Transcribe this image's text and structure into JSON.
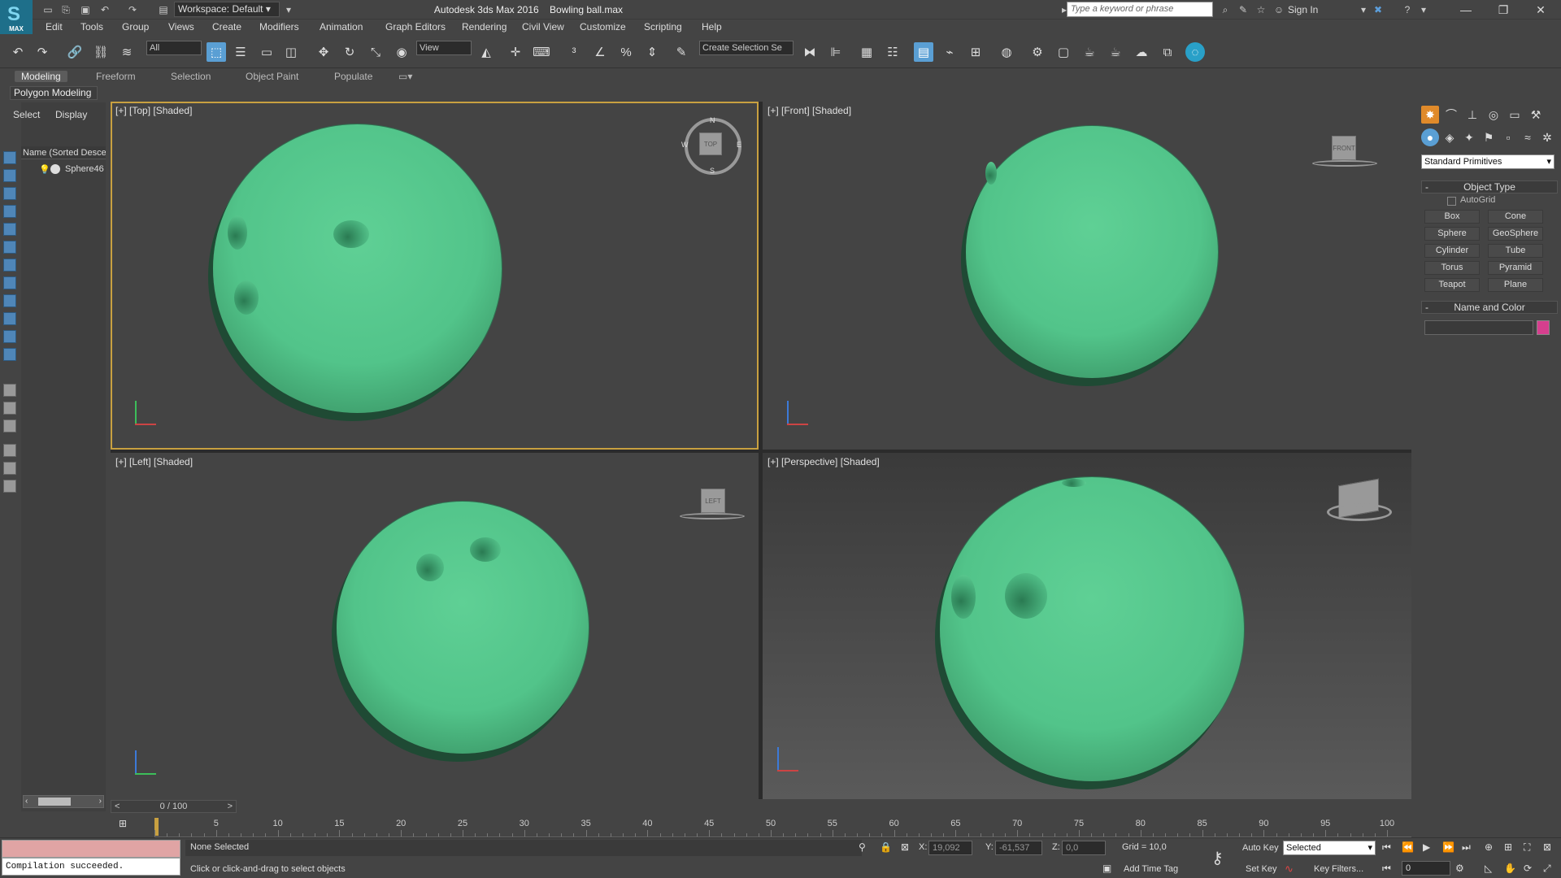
{
  "app": {
    "logo_label": "MAX",
    "workspace": "Workspace: Default",
    "title": "Autodesk 3ds Max 2016",
    "file": "Bowling ball.max",
    "search_placeholder": "Type a keyword or phrase",
    "signin": "Sign In"
  },
  "menus": [
    "Edit",
    "Tools",
    "Group",
    "Views",
    "Create",
    "Modifiers",
    "Animation",
    "Graph Editors",
    "Rendering",
    "Civil View",
    "Customize",
    "Scripting",
    "Help"
  ],
  "toolbar": {
    "filter": "All",
    "refcoord": "View",
    "selection_set": "Create Selection Se"
  },
  "ribbon": {
    "tabs": [
      "Modeling",
      "Freeform",
      "Selection",
      "Object Paint",
      "Populate"
    ],
    "active": "Modeling",
    "panel": "Polygon Modeling"
  },
  "scene_explorer": {
    "tabs": [
      "Select",
      "Display"
    ],
    "column": "Name (Sorted Desce",
    "object": "Sphere46"
  },
  "viewports": {
    "top": "[+] [Top] [Shaded]",
    "front": "[+] [Front] [Shaded]",
    "left": "[+] [Left] [Shaded]",
    "perspective": "[+] [Perspective] [Shaded]",
    "cube_top": "TOP",
    "cube_front": "FRONT",
    "cube_left": "LEFT",
    "compass": {
      "n": "N",
      "s": "S",
      "e": "E",
      "w": "W"
    }
  },
  "command_panel": {
    "category": "Standard Primitives",
    "object_type_title": "Object Type",
    "autogrid": "AutoGrid",
    "buttons": [
      "Box",
      "Cone",
      "Sphere",
      "GeoSphere",
      "Cylinder",
      "Tube",
      "Torus",
      "Pyramid",
      "Teapot",
      "Plane"
    ],
    "name_color_title": "Name and Color",
    "color": "#d63f8e"
  },
  "timeline": {
    "frame": "0 / 100",
    "ticks": [
      "5",
      "10",
      "15",
      "20",
      "25",
      "30",
      "35",
      "40",
      "45",
      "50",
      "55",
      "60",
      "65",
      "70",
      "75",
      "80",
      "85",
      "90",
      "95",
      "100"
    ]
  },
  "status": {
    "console": "Compilation succeeded.",
    "selection": "None Selected",
    "prompt": "Click or click-and-drag to select objects",
    "x": "19,092",
    "y": "-61,537",
    "z": "0,0",
    "grid": "Grid = 10,0",
    "add_time_tag": "Add Time Tag",
    "auto_key": "Auto Key",
    "set_key": "Set Key",
    "selected": "Selected",
    "key_filters": "Key Filters...",
    "current_frame": "0"
  },
  "colors": {
    "ball": "#52c48a",
    "active_viewport": "#c8a040",
    "command_active": "#e08a2a"
  }
}
